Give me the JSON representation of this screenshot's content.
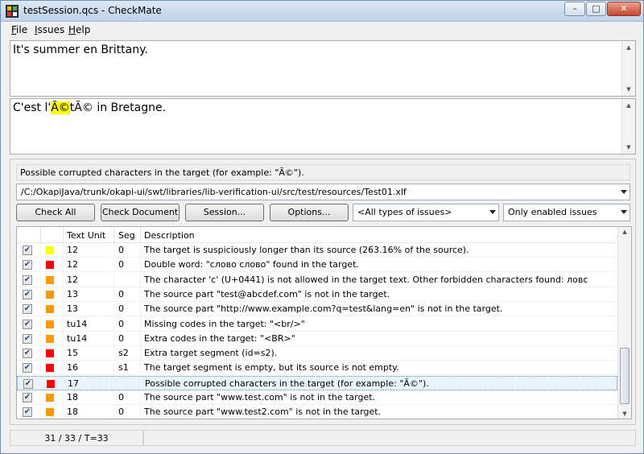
{
  "window": {
    "title": "testSession.qcs - CheckMate",
    "min_glyph": "–",
    "max_glyph": "□",
    "close_glyph": "✕"
  },
  "menu": {
    "file": {
      "hot": "F",
      "rest": "ile"
    },
    "issues": {
      "hot": "I",
      "rest": "ssues"
    },
    "help": {
      "hot": "H",
      "rest": "elp"
    }
  },
  "source_text": "It's summer en Brittany.",
  "target_text": {
    "before": "C'est l'",
    "highlighted": "Ã©",
    "after": "tÃ© in Bretagne."
  },
  "message": "Possible corrupted characters in the target (for example: \"Ã©\").",
  "document_path": "/C:/OkapiJava/trunk/okapi-ui/swt/libraries/lib-verification-ui/src/test/resources/Test01.xlf",
  "buttons": {
    "check_all": "Check All",
    "check_document": "Check Document",
    "session": "Session...",
    "options": "Options..."
  },
  "filters": {
    "issue_type": "<All types of issues>",
    "enabled": "Only enabled issues"
  },
  "columns": {
    "text_unit": "Text Unit",
    "seg": "Seg",
    "description": "Description"
  },
  "colors": {
    "yellow": "#ffff00",
    "red": "#ff0000",
    "orange": "#ff9900"
  },
  "rows": [
    {
      "checked": true,
      "severity": "yellow",
      "tu": "12",
      "seg": "0",
      "desc": "The target is suspiciously longer than its source (263.16% of the source)."
    },
    {
      "checked": true,
      "severity": "red",
      "tu": "12",
      "seg": "0",
      "desc": "Double word: \"слово слово\" found in the target."
    },
    {
      "checked": true,
      "severity": "orange",
      "tu": "12",
      "seg": "",
      "desc": "The character 'с' (U+0441) is not allowed in the target text. Other forbidden characters found: ловс"
    },
    {
      "checked": true,
      "severity": "orange",
      "tu": "13",
      "seg": "0",
      "desc": "The source part \"test@abcdef.com\" is not in the target."
    },
    {
      "checked": true,
      "severity": "orange",
      "tu": "13",
      "seg": "0",
      "desc": "The source part \"http://www.example.com?q=test&lang=en\" is not in the target."
    },
    {
      "checked": true,
      "severity": "orange",
      "tu": "tu14",
      "seg": "0",
      "desc": "Missing codes in the target: \"<br/>\""
    },
    {
      "checked": true,
      "severity": "orange",
      "tu": "tu14",
      "seg": "0",
      "desc": "Extra codes in the target: \"<BR>\""
    },
    {
      "checked": true,
      "severity": "red",
      "tu": "15",
      "seg": "s2",
      "desc": "Extra target segment (id=s2)."
    },
    {
      "checked": true,
      "severity": "red",
      "tu": "16",
      "seg": "s1",
      "desc": "The target segment is empty, but its source is not empty."
    },
    {
      "checked": true,
      "severity": "red",
      "tu": "17",
      "seg": "",
      "desc": "Possible corrupted characters in the target (for example: \"Ã©\").",
      "selected": true
    },
    {
      "checked": true,
      "severity": "orange",
      "tu": "18",
      "seg": "0",
      "desc": "The source part \"www.test.com\" is not in the target."
    },
    {
      "checked": true,
      "severity": "orange",
      "tu": "18",
      "seg": "0",
      "desc": "The source part \"www.test2.com\" is not in the target."
    }
  ],
  "status": {
    "count": "31 / 33 / T=33"
  }
}
